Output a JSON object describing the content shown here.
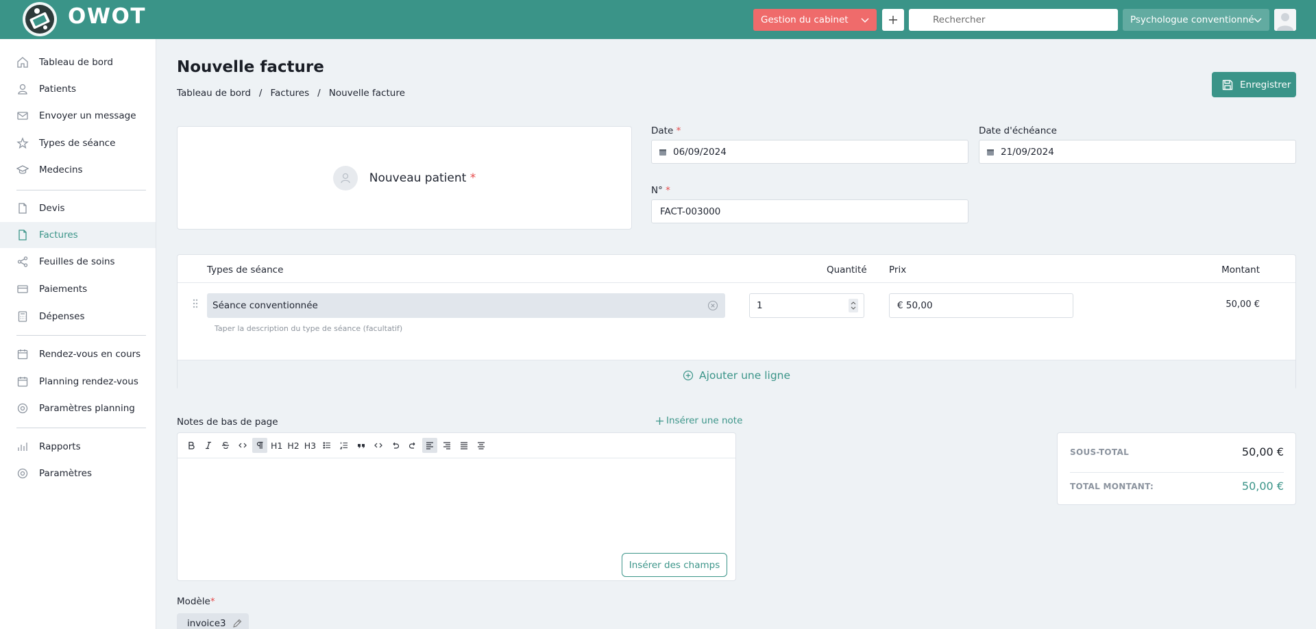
{
  "app": {
    "name": "OWOT"
  },
  "topbar": {
    "cabinet_label": "Gestion du cabinet",
    "search_placeholder": "Rechercher",
    "profile_label": "Psychologue conventionné"
  },
  "sidebar": {
    "items": [
      {
        "label": "Tableau de bord",
        "icon": "home-icon"
      },
      {
        "label": "Patients",
        "icon": "user-icon"
      },
      {
        "label": "Envoyer un message",
        "icon": "mail-icon"
      },
      {
        "label": "Types de séance",
        "icon": "star-icon"
      },
      {
        "label": "Medecins",
        "icon": "graduation-cap-icon"
      },
      {
        "label": "Devis",
        "icon": "file-icon"
      },
      {
        "label": "Factures",
        "icon": "invoice-file-icon",
        "active": true
      },
      {
        "label": "Feuilles de soins",
        "icon": "share-icon"
      },
      {
        "label": "Paiements",
        "icon": "credit-card-icon"
      },
      {
        "label": "Dépenses",
        "icon": "calculator-icon"
      },
      {
        "label": "Rendez-vous en cours",
        "icon": "calendar-icon"
      },
      {
        "label": "Planning rendez-vous",
        "icon": "calendar-icon"
      },
      {
        "label": "Paramètres planning",
        "icon": "gear-icon"
      },
      {
        "label": "Rapports",
        "icon": "bar-chart-icon"
      },
      {
        "label": "Paramètres",
        "icon": "gear-icon"
      }
    ]
  },
  "page": {
    "title": "Nouvelle facture",
    "breadcrumb": [
      "Tableau de bord",
      "Factures",
      "Nouvelle facture"
    ],
    "save_label": "Enregistrer"
  },
  "patient": {
    "label": "Nouveau patient"
  },
  "form": {
    "date_label": "Date",
    "date_value": "06/09/2024",
    "due_label": "Date d'échéance",
    "due_value": "21/09/2024",
    "number_label": "N°",
    "number_value": "FACT-003000",
    "required_mark": "*"
  },
  "items": {
    "headers": {
      "type": "Types de séance",
      "qty": "Quantité",
      "price": "Prix",
      "amount": "Montant"
    },
    "rows": [
      {
        "type": "Séance conventionnée",
        "description_placeholder": "Taper la description du type de séance (facultatif)",
        "qty": "1",
        "price": "€ 50,00",
        "amount": "50,00 €"
      }
    ],
    "add_line_label": "Ajouter une ligne"
  },
  "notes": {
    "label": "Notes de bas de page",
    "insert_note_label": "Insérer une note",
    "insert_fields_label": "Insérer des champs",
    "toolbar": [
      "bold",
      "italic",
      "strikethrough",
      "code",
      "paragraph",
      "H1",
      "H2",
      "H3",
      "bullet-list",
      "ordered-list",
      "quote",
      "code-block",
      "undo",
      "redo",
      "align-left",
      "align-right",
      "align-justify",
      "align-center"
    ]
  },
  "totals": {
    "subtotal_label": "SOUS-TOTAL",
    "subtotal_value": "50,00 €",
    "total_label": "TOTAL MONTANT:",
    "total_value": "50,00 €"
  },
  "model": {
    "label": "Modèle",
    "value": "invoice3"
  },
  "colors": {
    "primary": "#3a9488",
    "danger": "#ef6b6b",
    "required": "#e64b4b"
  }
}
